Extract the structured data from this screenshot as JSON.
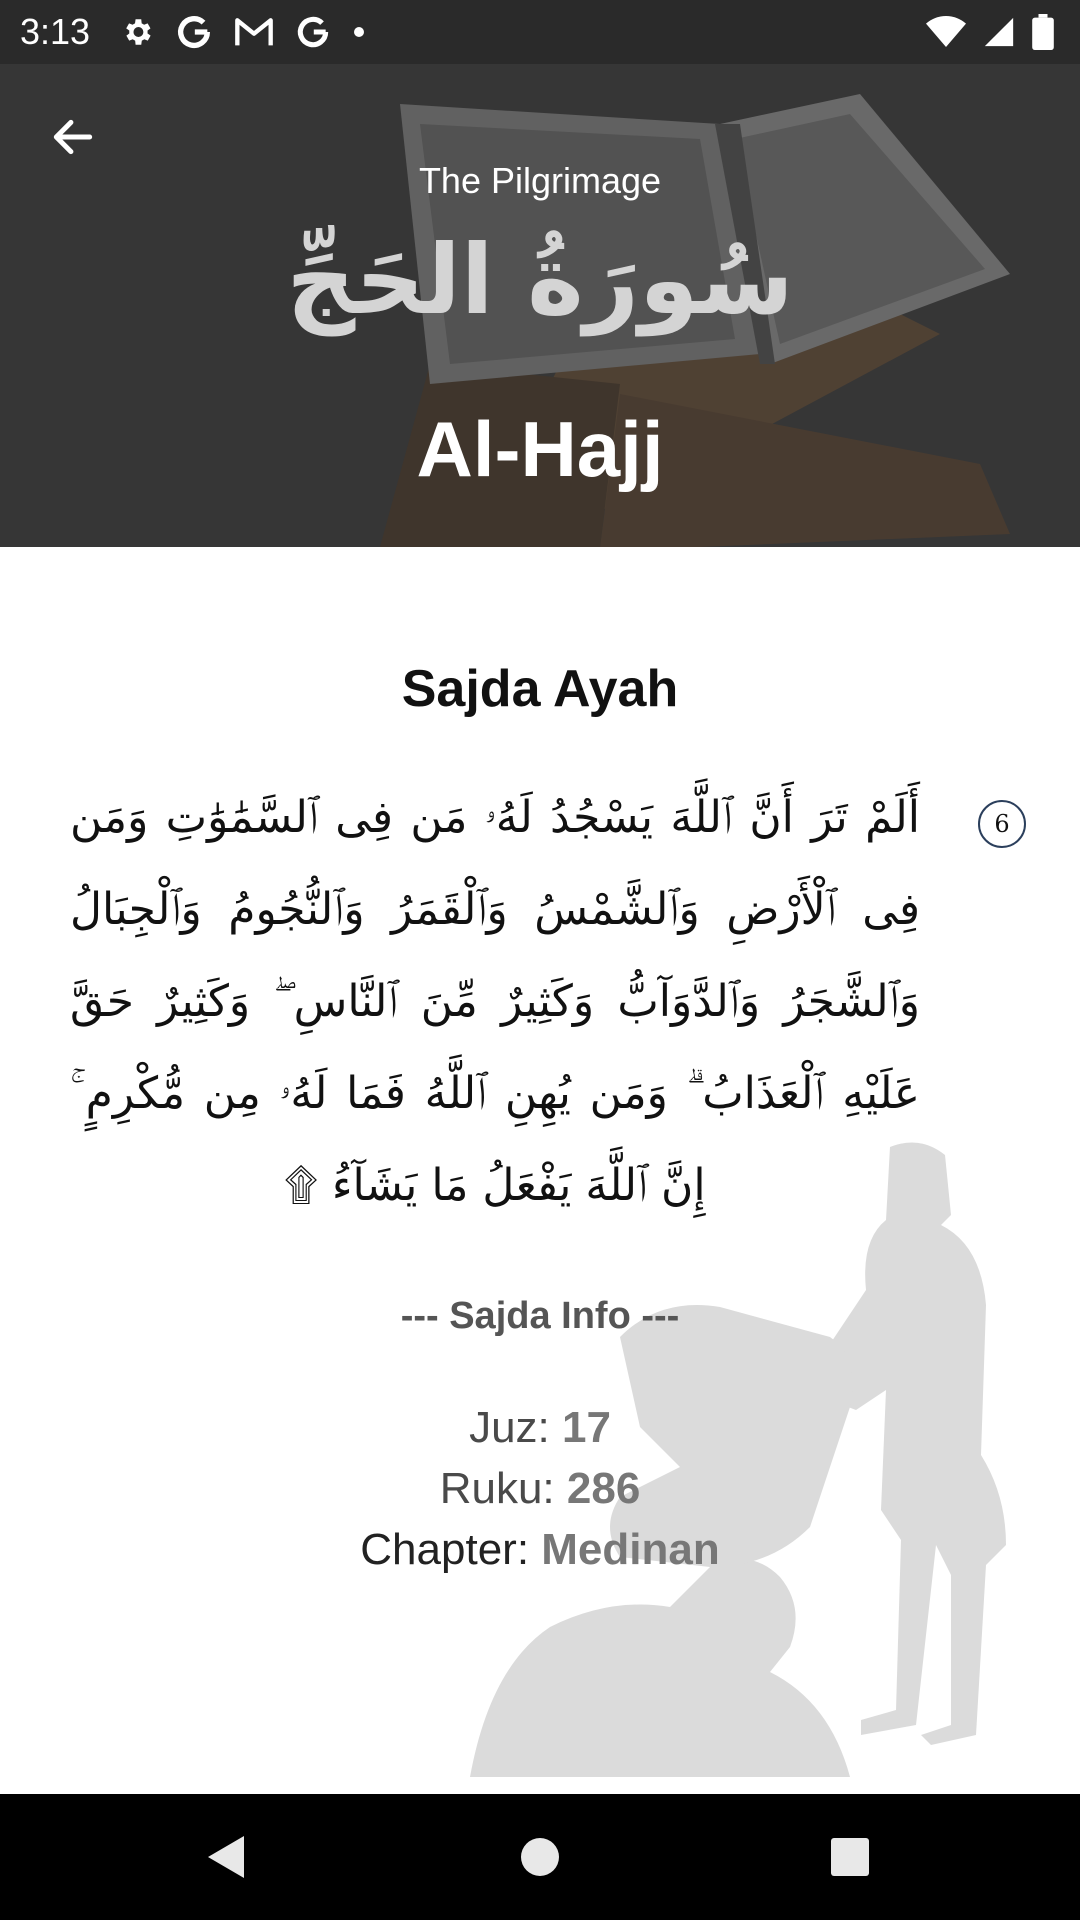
{
  "status_bar": {
    "time": "3:13",
    "notification_icons": [
      "gear-icon",
      "google-icon",
      "gmail-icon",
      "google-icon",
      "dot-icon"
    ],
    "right_icons": [
      "wifi-icon",
      "signal-icon",
      "battery-icon"
    ]
  },
  "header": {
    "subtitle": "The Pilgrimage",
    "arabic_name": "سُورَةُ الحَجِّ",
    "latin_name": "Al-Hajj"
  },
  "main": {
    "section_title": "Sajda Ayah",
    "ayah_number": "6",
    "ayah_text": "أَلَمْ تَرَ أَنَّ ٱللَّهَ يَسْجُدُ لَهُۥ مَن فِى ٱلسَّمَٰوَٰتِ وَمَن فِى ٱلْأَرْضِ وَٱلشَّمْسُ وَٱلْقَمَرُ وَٱلنُّجُومُ وَٱلْجِبَالُ وَٱلشَّجَرُ وَٱلدَّوَآبُّ وَكَثِيرٌ مِّنَ ٱلنَّاسِ ۖ وَكَثِيرٌ حَقَّ عَلَيْهِ ٱلْعَذَابُ ۗ وَمَن يُهِنِ ٱللَّهُ فَمَا لَهُۥ مِن مُّكْرِمٍ ۚ إِنَّ ٱللَّهَ يَفْعَلُ مَا يَشَآءُ ۩",
    "info_title": "--- Sajda Info ---",
    "juz_label": "Juz: ",
    "juz_value": "17",
    "ruku_label": "Ruku: ",
    "ruku_value": "286",
    "chapter_label": "Chapter: ",
    "chapter_value": "Medinan"
  },
  "nav_bar": {
    "buttons": [
      "back-triangle-icon",
      "home-circle-icon",
      "recents-square-icon"
    ]
  },
  "colors": {
    "header_bg": "#3c3c3c",
    "status_bar_bg": "#2a2a2a",
    "nav_bar_bg": "#000000",
    "ayah_circle": "#2b3f5c"
  }
}
